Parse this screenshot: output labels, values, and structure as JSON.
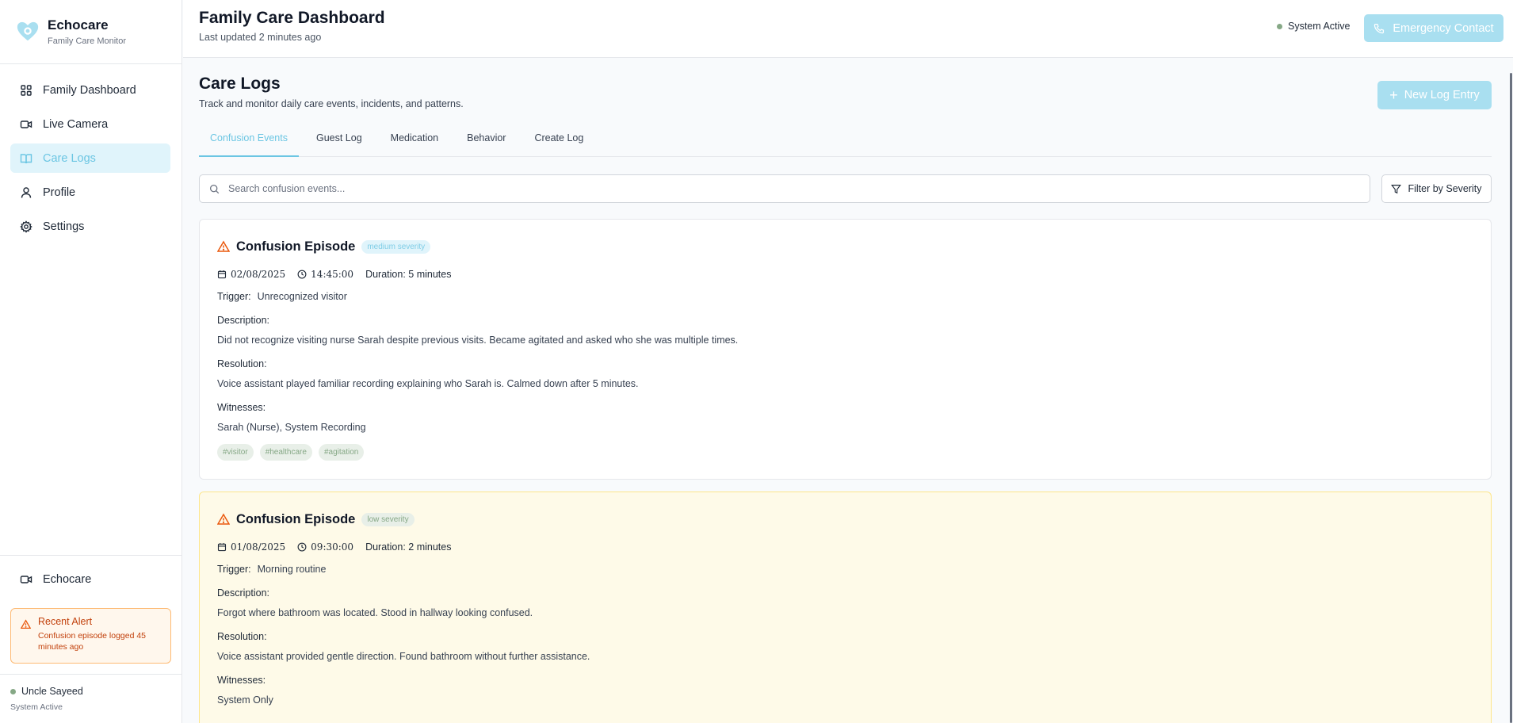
{
  "brand": {
    "name": "Echocare",
    "subtitle": "Family Care Monitor"
  },
  "sidebar": {
    "items": [
      {
        "label": "Family Dashboard",
        "icon": "grid-icon"
      },
      {
        "label": "Live Camera",
        "icon": "video-icon"
      },
      {
        "label": "Care Logs",
        "icon": "book-icon",
        "active": true
      },
      {
        "label": "Profile",
        "icon": "user-icon"
      },
      {
        "label": "Settings",
        "icon": "gear-icon"
      }
    ],
    "bottom_item": {
      "label": "Echocare",
      "icon": "video-icon"
    },
    "alert": {
      "title": "Recent Alert",
      "text": "Confusion episode logged 45 minutes ago"
    },
    "user": {
      "name": "Uncle Sayeed",
      "status": "System Active"
    }
  },
  "header": {
    "title": "Family Care Dashboard",
    "subtitle": "Last updated 2 minutes ago",
    "status": "System Active",
    "emergency_label": "Emergency Contact"
  },
  "main": {
    "title": "Care Logs",
    "subtitle": "Track and monitor daily care events, incidents, and patterns.",
    "new_entry_label": "New Log Entry",
    "tabs": [
      {
        "label": "Confusion Events",
        "active": true
      },
      {
        "label": "Guest Log"
      },
      {
        "label": "Medication"
      },
      {
        "label": "Behavior"
      },
      {
        "label": "Create Log"
      }
    ],
    "search": {
      "placeholder": "Search confusion events...",
      "value": ""
    },
    "filter_label": "Filter by Severity",
    "labels": {
      "trigger": "Trigger:",
      "description": "Description:",
      "resolution": "Resolution:",
      "witnesses": "Witnesses:"
    },
    "events": [
      {
        "title": "Confusion Episode",
        "severity": "medium severity",
        "date": "02/08/2025",
        "time": "14:45:00",
        "duration": "Duration: 5 minutes",
        "trigger": "Unrecognized visitor",
        "description": "Did not recognize visiting nurse Sarah despite previous visits. Became agitated and asked who she was multiple times.",
        "resolution": "Voice assistant played familiar recording explaining who Sarah is. Calmed down after 5 minutes.",
        "witnesses": "Sarah (Nurse), System Recording",
        "tags": [
          "#visitor",
          "#healthcare",
          "#agitation"
        ]
      },
      {
        "title": "Confusion Episode",
        "severity": "low severity",
        "date": "01/08/2025",
        "time": "09:30:00",
        "duration": "Duration: 2 minutes",
        "trigger": "Morning routine",
        "description": "Forgot where bathroom was located. Stood in hallway looking confused.",
        "resolution": "Voice assistant provided gentle direction. Found bathroom without further assistance.",
        "witnesses": "System Only",
        "tags": []
      }
    ]
  },
  "colors": {
    "accent": "#6cc6e3",
    "accent_light": "#a9dff0",
    "alert": "#c2410c",
    "status_dot": "#86a886",
    "highlight_card": "#fefae8"
  }
}
